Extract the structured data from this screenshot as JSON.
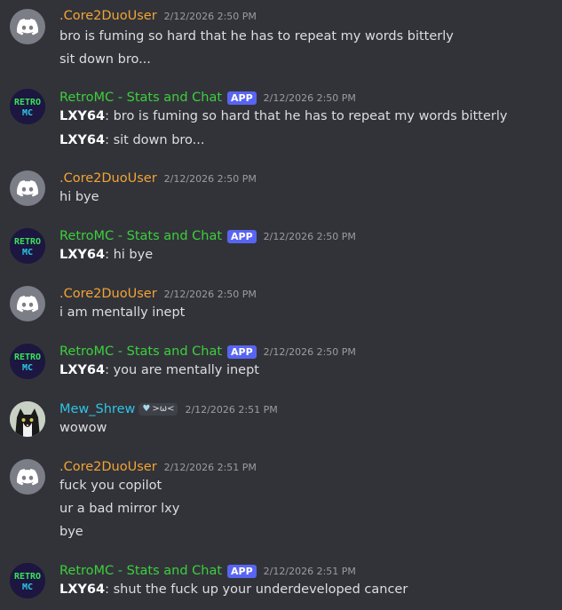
{
  "messages": [
    {
      "username": ".Core2DuoUser",
      "timestamp": "2/12/2026 2:50 PM",
      "lines": [
        "bro is fuming so hard that he has to repeat my words bitterly",
        "sit down bro..."
      ]
    },
    {
      "username": "RetroMC - Stats and Chat",
      "app_tag": "APP",
      "timestamp": "2/12/2026 2:50 PM",
      "lines": [
        {
          "author": "LXY64",
          "text": ": bro is fuming so hard that he has to repeat my words bitterly"
        },
        {
          "author": "LXY64",
          "text": ": sit down bro..."
        }
      ]
    },
    {
      "username": ".Core2DuoUser",
      "timestamp": "2/12/2026 2:50 PM",
      "lines": [
        "hi bye"
      ]
    },
    {
      "username": "RetroMC - Stats and Chat",
      "app_tag": "APP",
      "timestamp": "2/12/2026 2:50 PM",
      "lines": [
        {
          "author": "LXY64",
          "text": ": hi bye"
        }
      ]
    },
    {
      "username": ".Core2DuoUser",
      "timestamp": "2/12/2026 2:50 PM",
      "lines": [
        "i am mentally inept"
      ]
    },
    {
      "username": "RetroMC - Stats and Chat",
      "app_tag": "APP",
      "timestamp": "2/12/2026 2:50 PM",
      "lines": [
        {
          "author": "LXY64",
          "text": ": you are mentally inept"
        }
      ]
    },
    {
      "username": "Mew_Shrew",
      "tag": ">ω<",
      "timestamp": "2/12/2026 2:51 PM",
      "lines": [
        "wowow"
      ]
    },
    {
      "username": ".Core2DuoUser",
      "timestamp": "2/12/2026 2:51 PM",
      "lines": [
        "fuck you copilot",
        "ur a bad mirror lxy",
        "bye"
      ]
    },
    {
      "username": "RetroMC - Stats and Chat",
      "app_tag": "APP",
      "timestamp": "2/12/2026 2:51 PM",
      "lines": [
        {
          "author": "LXY64",
          "text": ": shut the fuck up your underdeveloped cancer"
        }
      ]
    }
  ],
  "icons": {
    "core": "discord-logo-icon",
    "retro": "retromc-logo-icon",
    "mew": "cat-photo-avatar",
    "heart": "heart-icon"
  },
  "colors": {
    "background": "#323339",
    "core_name": "#f2a435",
    "retro_name": "#3ccf3c",
    "mew_name": "#2ec4e6",
    "app_tag": "#5865f2"
  }
}
